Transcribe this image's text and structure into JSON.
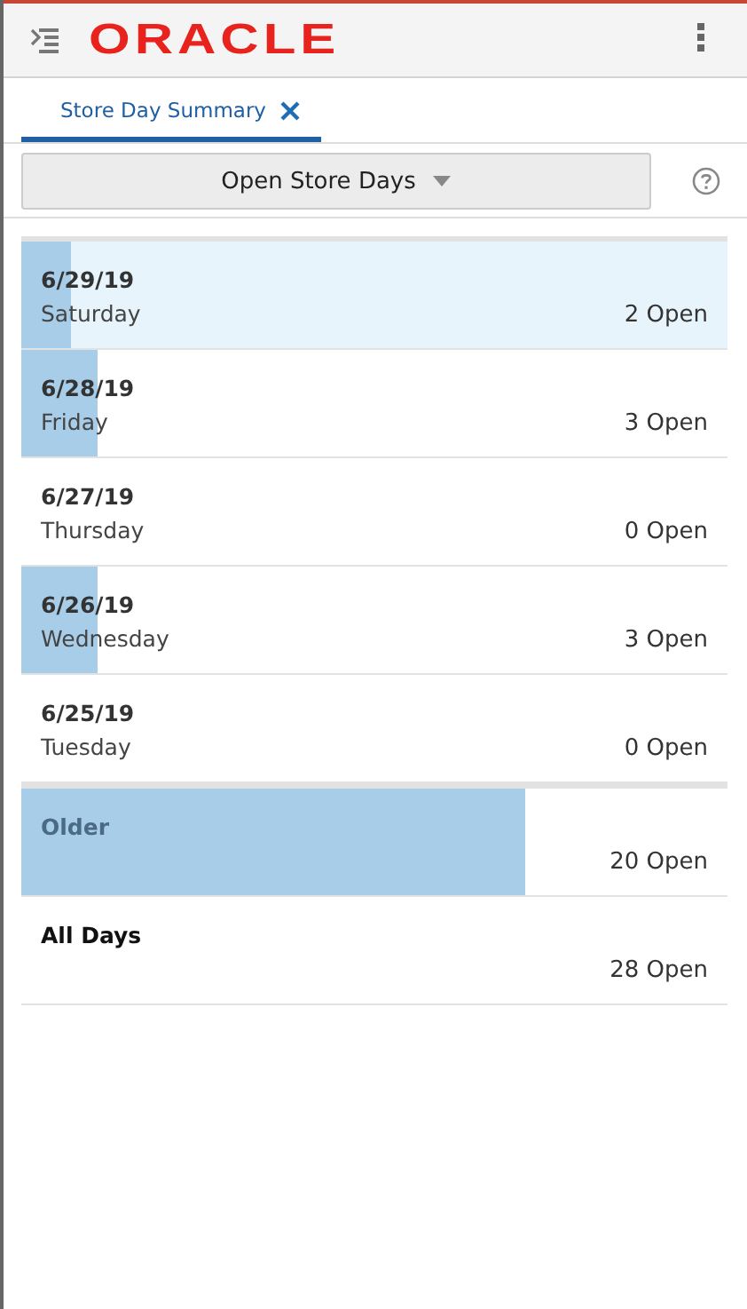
{
  "header": {
    "logo": "ORACLE"
  },
  "tabs": [
    {
      "label": "Store Day Summary",
      "selected": true
    }
  ],
  "filter": {
    "label": "Open Store Days"
  },
  "sections": [
    {
      "rows": [
        {
          "kind": "day",
          "date": "6/29/19",
          "day": "Saturday",
          "count": "2 Open",
          "level": 0.071,
          "selected": true
        },
        {
          "kind": "day",
          "date": "6/28/19",
          "day": "Friday",
          "count": "3 Open",
          "level": 0.107,
          "selected": false
        },
        {
          "kind": "day",
          "date": "6/27/19",
          "day": "Thursday",
          "count": "0 Open",
          "selected": false
        },
        {
          "kind": "day",
          "date": "6/26/19",
          "day": "Wednesday",
          "count": "3 Open",
          "level": 0.107,
          "selected": false
        },
        {
          "kind": "day",
          "date": "6/25/19",
          "day": "Tuesday",
          "count": "0 Open",
          "selected": false
        }
      ]
    },
    {
      "rows": [
        {
          "kind": "older",
          "date": "Older",
          "count": "20 Open",
          "level": 0.714,
          "selected": false
        },
        {
          "kind": "total",
          "date": "All Days",
          "count": "28 Open",
          "selected": false
        }
      ]
    }
  ]
}
